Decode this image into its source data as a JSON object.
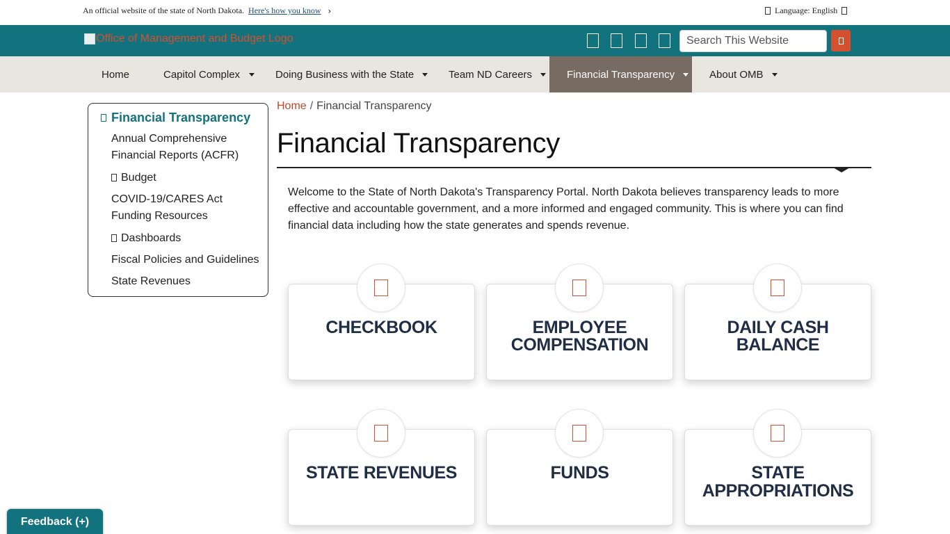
{
  "banner": {
    "official_text": "An official website of the state of North Dakota.",
    "how_link": "Here's how you know",
    "language_label": "Language: English"
  },
  "header": {
    "logo_alt": "Office of Management and Budget Logo",
    "search_placeholder": "Search This Website",
    "social_icons": [
      "facebook-icon",
      "twitter-icon",
      "linkedin-icon",
      "youtube-icon"
    ]
  },
  "nav": {
    "items": [
      {
        "label": "Home"
      },
      {
        "label": "Capitol Complex"
      },
      {
        "label": "Doing Business with the State"
      },
      {
        "label": "Team ND Careers"
      },
      {
        "label": "Financial Transparency"
      },
      {
        "label": "About OMB"
      }
    ]
  },
  "sidebar": {
    "title": "Financial Transparency",
    "items": [
      {
        "label": "Annual Comprehensive Financial Reports (ACFR)"
      },
      {
        "label": "Budget"
      },
      {
        "label": "COVID-19/CARES Act Funding Resources"
      },
      {
        "label": "Dashboards"
      },
      {
        "label": "Fiscal Policies and Guidelines"
      },
      {
        "label": "State Revenues"
      }
    ]
  },
  "breadcrumb": {
    "home": "Home",
    "separator": "/",
    "current": "Financial Transparency"
  },
  "page": {
    "title": "Financial Transparency",
    "intro": "Welcome to the State of North Dakota's Transparency Portal. North Dakota believes transparency leads to more effective and accountable government, and a more informed and engaged community. This is where you can find financial data including how the state generates and spends revenue."
  },
  "cards": [
    {
      "line1": "CHECKBOOK",
      "line2": ""
    },
    {
      "line1": "EMPLOYEE",
      "line2": "COMPENSATION"
    },
    {
      "line1": "DAILY CASH",
      "line2": "BALANCE"
    },
    {
      "line1": "STATE REVENUES",
      "line2": ""
    },
    {
      "line1": "FUNDS",
      "line2": ""
    },
    {
      "line1": "STATE",
      "line2": "APPROPRIATIONS"
    }
  ],
  "feedback": {
    "label": "Feedback (+)"
  },
  "colors": {
    "header_teal": "#12727e",
    "accent_orange": "#d4502e",
    "nav_bg": "#e9e6e0",
    "nav_active": "#776b62",
    "card_text": "#1f2e45"
  }
}
